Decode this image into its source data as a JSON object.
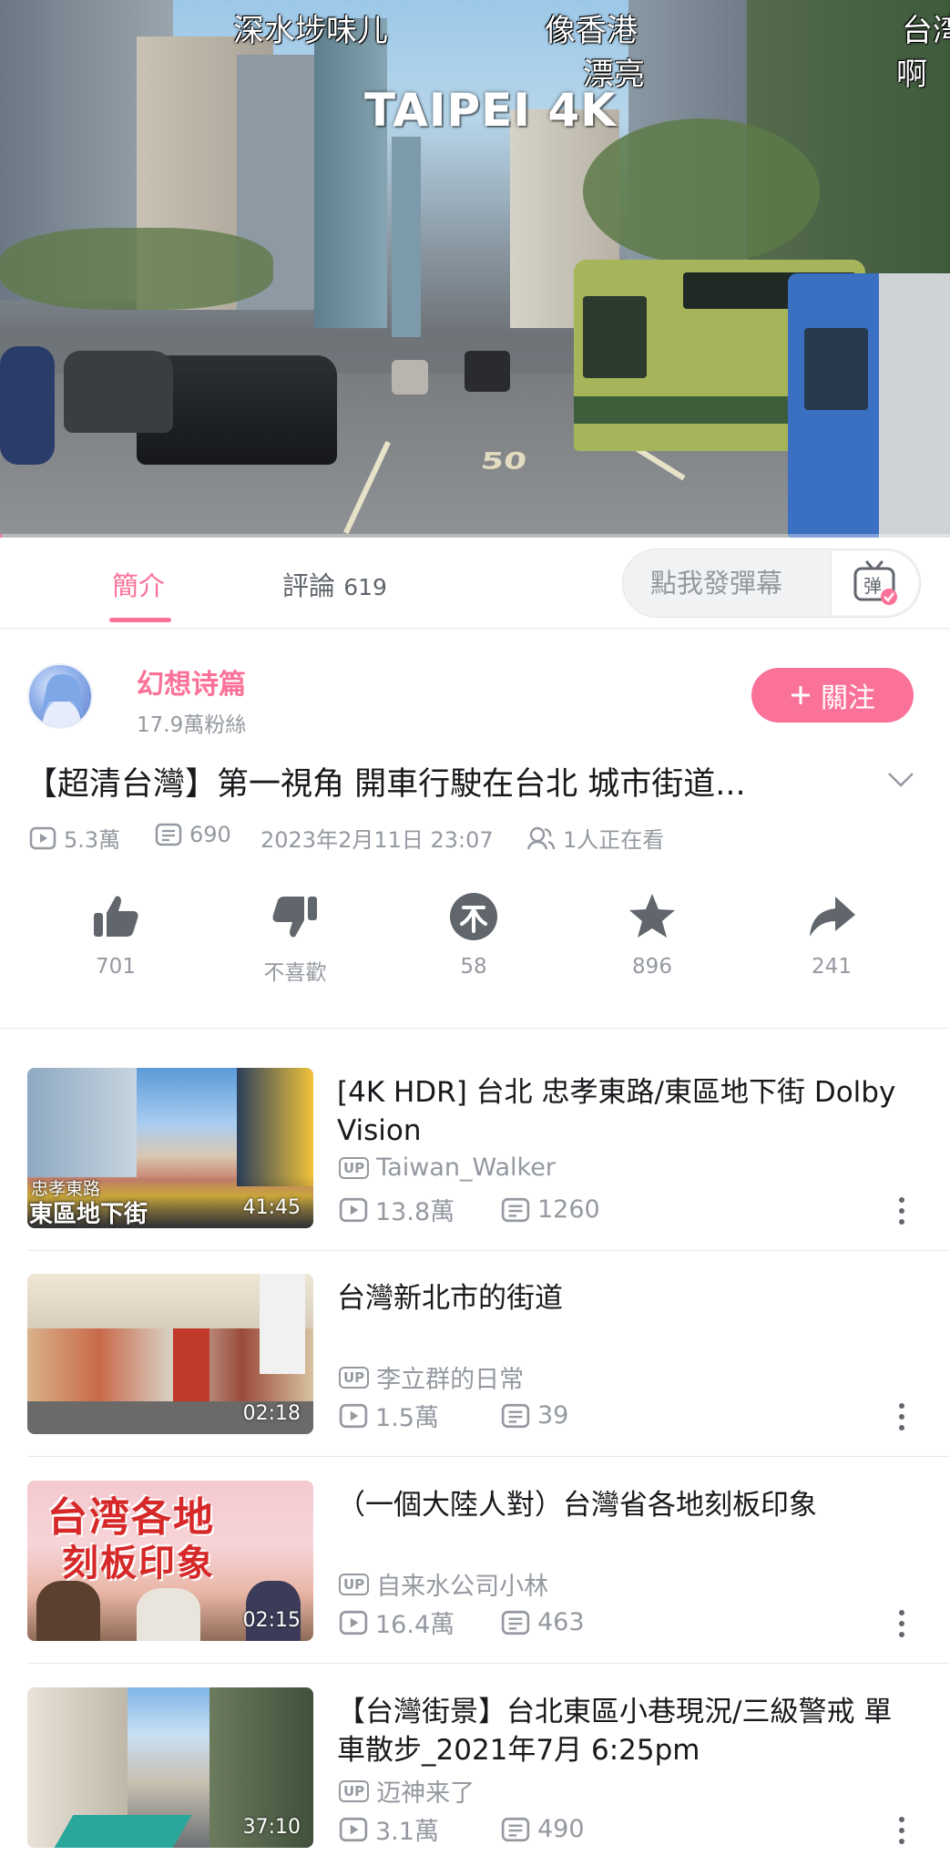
{
  "player": {
    "overlay_title": "TAIPEI 4K",
    "danmaku": [
      "深水埗味儿",
      "像香港",
      "漂亮",
      "台湾",
      "啊"
    ],
    "progress": 0.002,
    "road_marking": "50"
  },
  "tabs": {
    "intro_label": "簡介",
    "comments_label": "評論",
    "comments_count": "619",
    "danmaku_placeholder": "點我發彈幕",
    "danmaku_button_label": "弹"
  },
  "uploader": {
    "name": "幻想诗篇",
    "fans": "17.9萬粉絲",
    "follow_label": "關注"
  },
  "video": {
    "title": "【超清台灣】第一視角 開車行駛在台北 城市街道...",
    "views": "5.3萬",
    "danmaku_count": "690",
    "date": "2023年2月11日 23:07",
    "watching": "1人正在看"
  },
  "actions": {
    "like": "701",
    "dislike": "不喜歡",
    "coin": "58",
    "favorite": "896",
    "share": "241"
  },
  "recommendations": [
    {
      "title": "[4K HDR] 台北 忠孝東路/東區地下街 Dolby Vision",
      "up": "Taiwan_Walker",
      "views": "13.8萬",
      "danmaku": "1260",
      "duration": "41:45",
      "thumb_text_1": "忠孝東路",
      "thumb_text_2": "東區地下街"
    },
    {
      "title": "台灣新北市的街道",
      "up": "李立群的日常",
      "views": "1.5萬",
      "danmaku": "39",
      "duration": "02:18"
    },
    {
      "title": "（一個大陸人對）台灣省各地刻板印象",
      "up": "自来水公司小林",
      "views": "16.4萬",
      "danmaku": "463",
      "duration": "02:15",
      "thumb_text_1": "台湾各地",
      "thumb_text_2": "刻板印象"
    },
    {
      "title": "【台灣街景】台北東區小巷現況/三級警戒 單車散步_2021年7月 6:25pm",
      "up": "迈神来了",
      "views": "3.1萬",
      "danmaku": "490",
      "duration": "37:10"
    }
  ],
  "up_badge": "UP",
  "colors": {
    "accent": "#fb7299",
    "secondary_text": "#9499a0"
  }
}
